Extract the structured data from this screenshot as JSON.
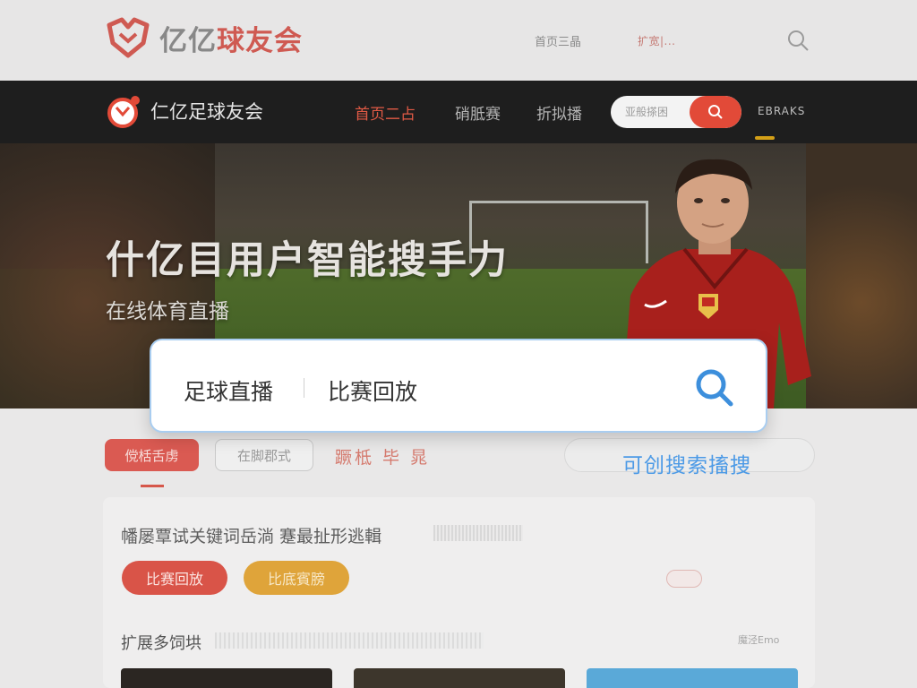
{
  "top_header": {
    "brand_grey": "亿亿",
    "brand_red": "球友会",
    "nav_text": "首页三晶",
    "pill_text": "扩宽|...",
    "search_icon": "search-icon"
  },
  "nav_bar": {
    "brand": "仁亿足球友会",
    "items": [
      {
        "label": "首页二占",
        "active": true
      },
      {
        "label": "硝胝赛",
        "active": false
      },
      {
        "label": "折拟播",
        "active": false
      }
    ],
    "search_placeholder": "亚般搽困",
    "user_text": "EBRAKS"
  },
  "hero": {
    "title": "什亿目用户智能搜手力",
    "subtitle": "在线体育直播"
  },
  "search": {
    "keyword_1": "足球直播",
    "keyword_2": "比赛回放",
    "icon": "search-icon",
    "hint": "可创搜索搐捜"
  },
  "filters": {
    "chip_active": "傥栝舌虏",
    "chip_outline": "在脚郡式",
    "tabs_text": "蹶柢 毕 晁"
  },
  "content": {
    "description": "幡屡覃试关键词岳淌 蹇最扯形逃輯",
    "btn_replay": "比赛回放",
    "btn_highlights": "比底賓膀",
    "section_title": "扩展多饲垬",
    "section_more": "魔泾Emo"
  },
  "colors": {
    "accent_red": "#e24a38",
    "accent_blue": "#4c9ae6",
    "accent_gold": "#dfa43a"
  }
}
